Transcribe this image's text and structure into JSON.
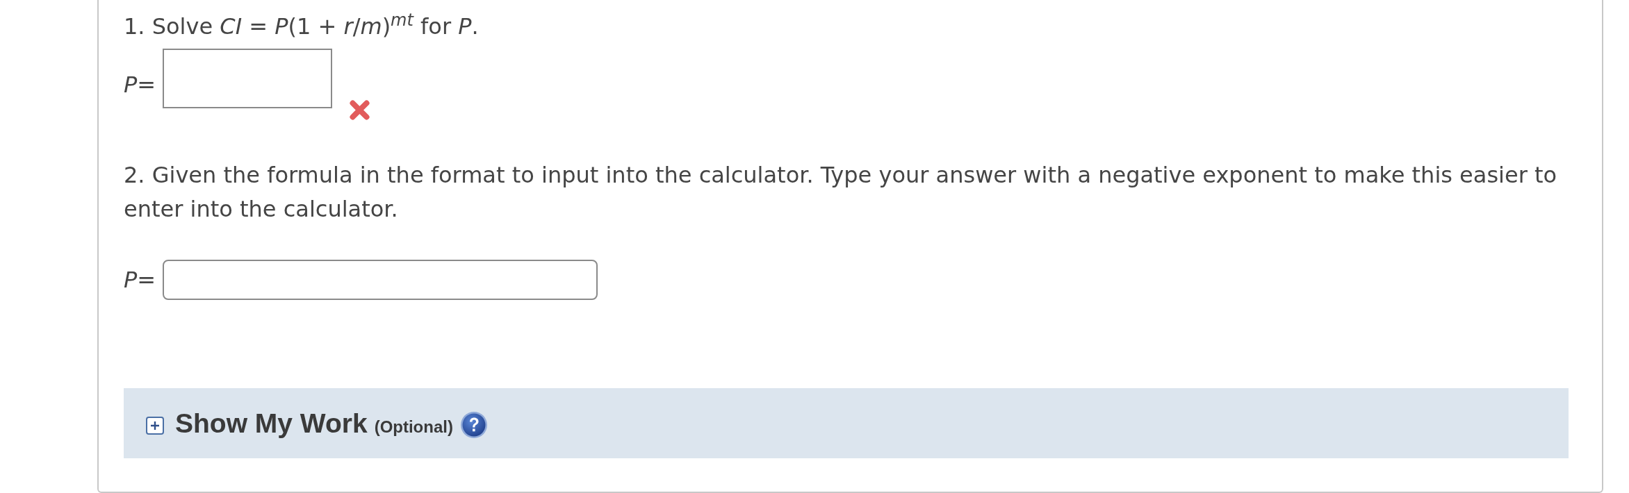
{
  "questions": [
    {
      "prompt": "1. Solve *CI* = *P*(1 + *r*/*m*)$^{mt}$ for *P*.",
      "answer": {
        "kind": "math",
        "label": "*P*=",
        "incorrect": true
      }
    },
    {
      "prompt": "2. Given the formula in the format to input into the calculator. Type your answer with a negative exponent to make this easier to enter into the calculator.",
      "answer": {
        "kind": "text",
        "label": "*P*=",
        "incorrect": false
      }
    }
  ],
  "show_my_work": {
    "title": "Show My Work",
    "note": "(Optional)",
    "expanded": false
  }
}
